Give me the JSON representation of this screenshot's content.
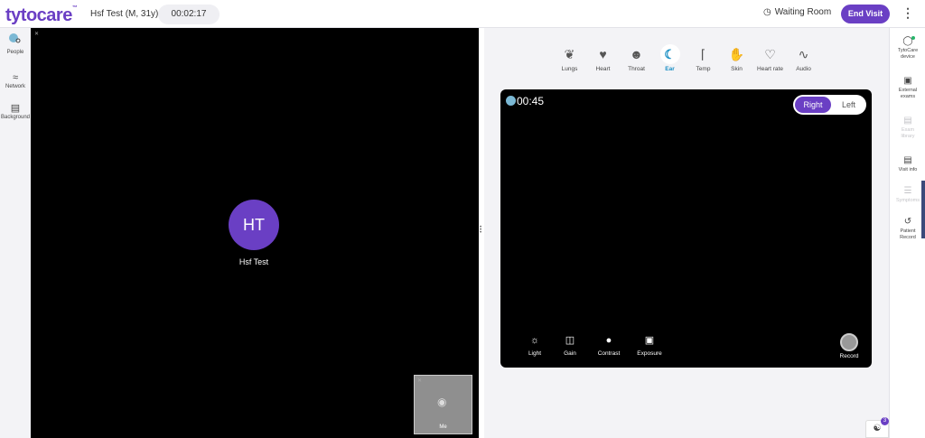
{
  "header": {
    "logo": "tytocare",
    "logo_tm": "™",
    "patient": "Hsf Test (M, 31y)",
    "timer": "00:02:17",
    "waiting_room": "Waiting Room",
    "end_visit": "End Visit"
  },
  "left_rail": {
    "people": "People",
    "network": "Network",
    "background": "Background"
  },
  "video": {
    "initials": "HT",
    "name": "Hsf Test",
    "self_label": "Me"
  },
  "exam_tabs": [
    {
      "label": "Lungs",
      "icon": "lungs-icon"
    },
    {
      "label": "Heart",
      "icon": "heart-icon"
    },
    {
      "label": "Throat",
      "icon": "throat-icon"
    },
    {
      "label": "Ear",
      "icon": "ear-icon"
    },
    {
      "label": "Temp",
      "icon": "thermometer-icon"
    },
    {
      "label": "Skin",
      "icon": "skin-icon"
    },
    {
      "label": "Heart rate",
      "icon": "heart-rate-icon"
    },
    {
      "label": "Audio",
      "icon": "audio-icon"
    }
  ],
  "active_tab": "Ear",
  "camera": {
    "time": "00:45",
    "toggle_right": "Right",
    "toggle_left": "Left",
    "controls": [
      "Light",
      "Gain",
      "Contrast",
      "Exposure"
    ],
    "record": "Record"
  },
  "right_rail": {
    "tytocare_device_1": "TytoCare",
    "tytocare_device_2": "device",
    "external_exams_1": "External",
    "external_exams_2": "exams",
    "exam_library_1": "Exam",
    "exam_library_2": "library",
    "visit_info": "Visit info",
    "symptoms": "Symptoms",
    "patient_record_1": "Patient",
    "patient_record_2": "Record"
  },
  "chat_badge": "3",
  "colors": {
    "brand": "#6a3fc4",
    "active_tab": "#1a8fc4"
  }
}
